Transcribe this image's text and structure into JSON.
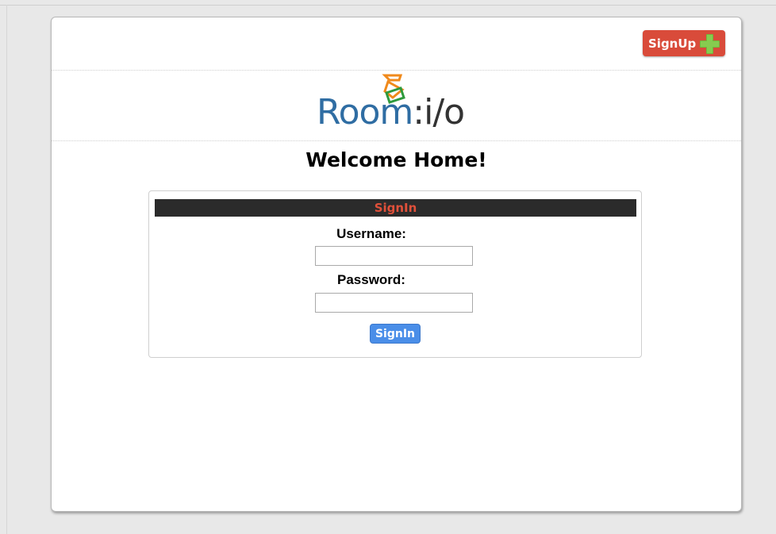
{
  "header": {
    "signup_label": "SignUp"
  },
  "logo": {
    "brand_main": "Room",
    "brand_suffix": ":i/o"
  },
  "welcome": {
    "title": "Welcome Home!"
  },
  "signin_form": {
    "section_title": "SignIn",
    "username_label": "Username:",
    "username_value": "",
    "password_label": "Password:",
    "password_value": "",
    "submit_label": "SignIn"
  },
  "colors": {
    "signup_button": "#d94b3a",
    "plus_icon": "#7ac142",
    "brand_blue": "#2f6da3",
    "section_bar": "#2b2b2b",
    "section_title_text": "#e0503a",
    "signin_button": "#4a8ee8"
  },
  "icons": {
    "signup": "plus-icon",
    "logo": "room-io-logo-mark"
  }
}
